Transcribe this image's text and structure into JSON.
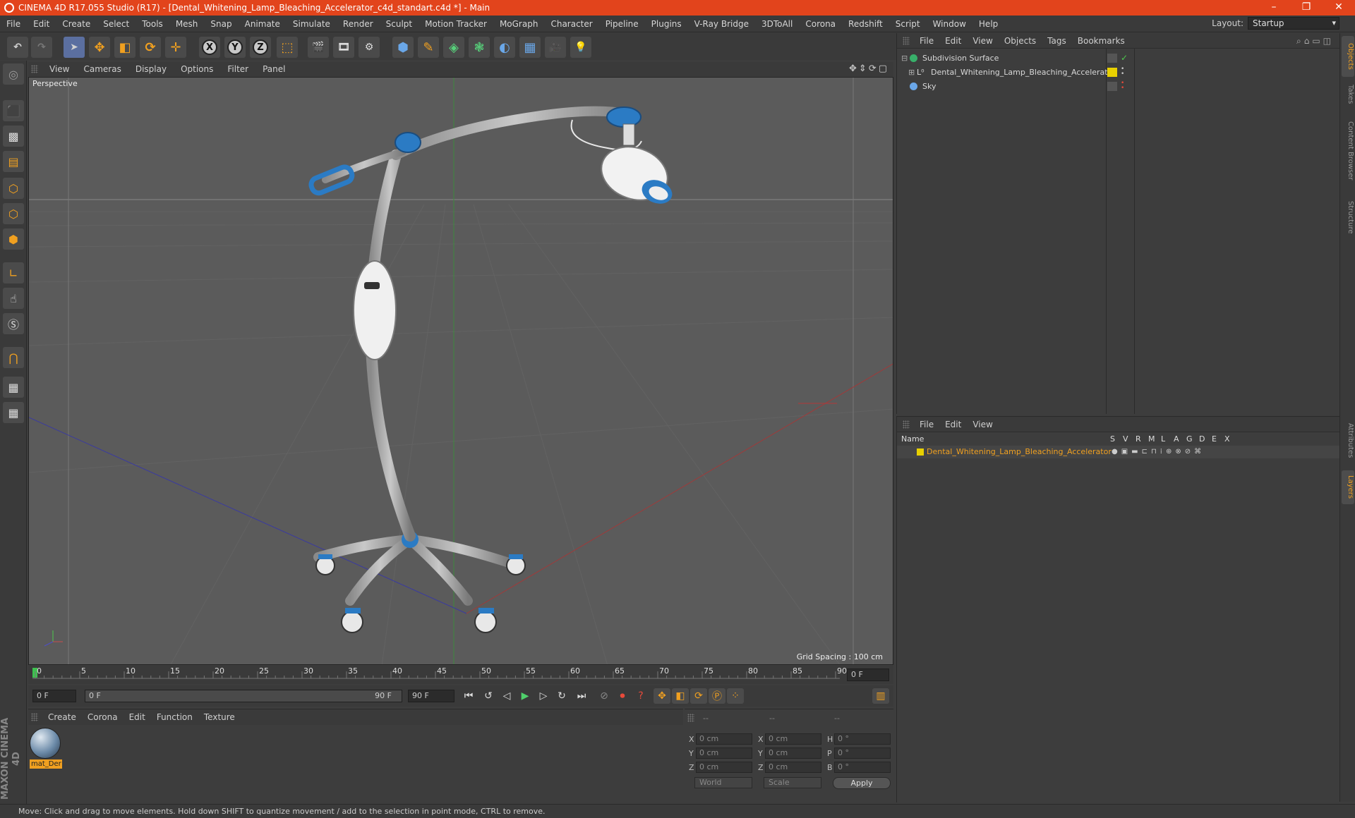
{
  "window": {
    "title": "CINEMA 4D R17.055 Studio (R17) - [Dental_Whitening_Lamp_Bleaching_Accelerator_c4d_standart.c4d *] - Main",
    "controls": [
      "–",
      "❐",
      "✕"
    ]
  },
  "menu": [
    "File",
    "Edit",
    "Create",
    "Select",
    "Tools",
    "Mesh",
    "Snap",
    "Animate",
    "Simulate",
    "Render",
    "Sculpt",
    "Motion Tracker",
    "MoGraph",
    "Character",
    "Pipeline",
    "Plugins",
    "V-Ray Bridge",
    "3DToAll",
    "Corona",
    "Redshift",
    "Script",
    "Window",
    "Help"
  ],
  "layout": {
    "label": "Layout:",
    "value": "Startup"
  },
  "toolbar": {
    "x": "X",
    "y": "Y",
    "z": "Z"
  },
  "viewport": {
    "menu": [
      "View",
      "Cameras",
      "Display",
      "Options",
      "Filter",
      "Panel"
    ],
    "camera": "Perspective",
    "grid_spacing": "Grid Spacing : 100 cm"
  },
  "timeline": {
    "ticks": [
      "0",
      "5",
      "10",
      "15",
      "20",
      "25",
      "30",
      "35",
      "40",
      "45",
      "50",
      "55",
      "60",
      "65",
      "70",
      "75",
      "80",
      "85",
      "90"
    ],
    "current_frame": "0 F"
  },
  "transport": {
    "start": "0 F",
    "range_start": "0 F",
    "range_end": "90 F",
    "end": "90 F"
  },
  "materials": {
    "menu": [
      "Create",
      "Corona",
      "Edit",
      "Function",
      "Texture"
    ],
    "items": [
      {
        "label": "mat_Der"
      }
    ]
  },
  "coords": {
    "headers": [
      "--",
      "--",
      "--"
    ],
    "rows": [
      {
        "a": "X",
        "v1": "0 cm",
        "b": "X",
        "v2": "0 cm",
        "c": "H",
        "v3": "0 °"
      },
      {
        "a": "Y",
        "v1": "0 cm",
        "b": "Y",
        "v2": "0 cm",
        "c": "P",
        "v3": "0 °"
      },
      {
        "a": "Z",
        "v1": "0 cm",
        "b": "Z",
        "v2": "0 cm",
        "c": "B",
        "v3": "0 °"
      }
    ],
    "space": "World",
    "mode": "Scale",
    "apply": "Apply"
  },
  "objects": {
    "menu": [
      "File",
      "Edit",
      "View",
      "Objects",
      "Tags",
      "Bookmarks"
    ],
    "items": [
      {
        "name": "Subdivision Surface"
      },
      {
        "name": "Dental_Whitening_Lamp_Bleaching_Accelerator"
      },
      {
        "name": "Sky"
      }
    ]
  },
  "layers": {
    "menu": [
      "File",
      "Edit",
      "View"
    ],
    "columns": [
      "Name",
      "S",
      "V",
      "R",
      "M",
      "L",
      "A",
      "G",
      "D",
      "E",
      "X"
    ],
    "items": [
      {
        "name": "Dental_Whitening_Lamp_Bleaching_Accelerator"
      }
    ]
  },
  "side_tabs": [
    "Objects",
    "Takes",
    "Content Browser",
    "Structure",
    "Attributes",
    "Layers"
  ],
  "brand": "MAXON CINEMA 4D",
  "status": "Move: Click and drag to move elements. Hold down SHIFT to quantize movement / add to the selection in point mode, CTRL to remove.",
  "colors": {
    "title_bar": "#e2441c",
    "accent": "#f0a020",
    "lamp_blue": "#2b7bc4"
  }
}
